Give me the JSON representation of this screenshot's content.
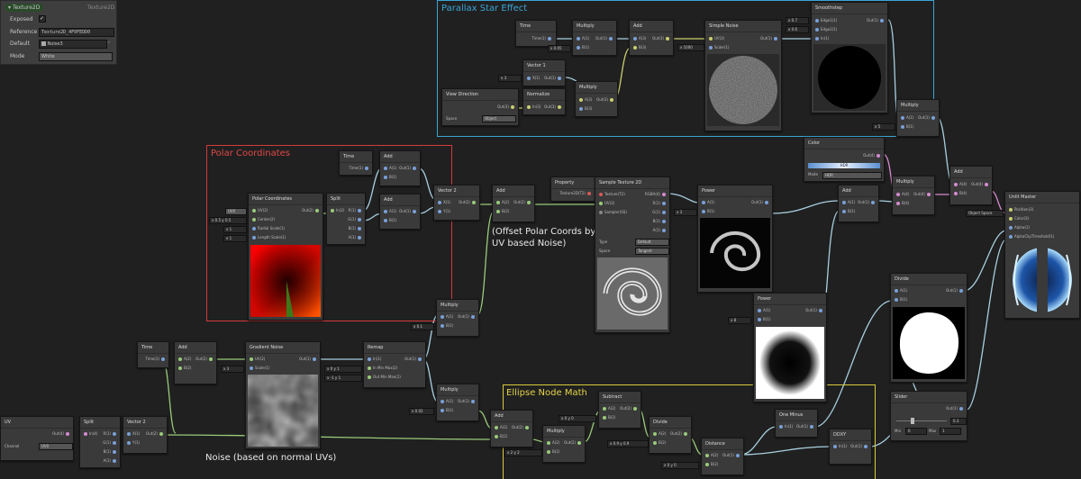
{
  "blackboard": {
    "property_name": "Texture2D",
    "property_type": "Texture2D",
    "exposed_label": "Exposed",
    "reference_label": "Reference",
    "reference_value": "Texture2D_4F0FEDD0",
    "default_label": "Default",
    "default_value": "Noise3",
    "mode_label": "Mode",
    "mode_value": "White"
  },
  "groups": {
    "parallax": "Parallax Star Effect",
    "polar": "Polar Coordinates",
    "ellipse": "Ellipse Node Math"
  },
  "comments": {
    "offset_line1": "(Offset Polar Coords by",
    "offset_line2": "UV based Noise)",
    "noise": "Noise (based on normal UVs)"
  },
  "nodes": {
    "time_top": {
      "title": "Time",
      "out": "Time(1)"
    },
    "multiply_top": {
      "title": "Multiply",
      "a": "A(1)",
      "b": "B(1)",
      "out": "Out(1)",
      "val": "0.05"
    },
    "add_top": {
      "title": "Add",
      "a": "A(3)",
      "b": "B(3)",
      "out": "Out(3)"
    },
    "simple_noise": {
      "title": "Simple Noise",
      "uv": "UV(2)",
      "scale": "Scale(1)",
      "out": "Out(1)",
      "val": "1000"
    },
    "smoothstep": {
      "title": "Smoothstep",
      "e1": "Edge1(1)",
      "e2": "Edge2(1)",
      "in": "In(1)",
      "out": "Out(1)",
      "v1": "0.7",
      "v2": "0.6"
    },
    "vector1": {
      "title": "Vector 1",
      "x": "X(1)",
      "out": "Out(1)",
      "val": "3"
    },
    "normalize": {
      "title": "Normalize",
      "in": "In(3)",
      "out": "Out(3)"
    },
    "multiply_par": {
      "title": "Multiply",
      "a": "A(3)",
      "b": "B(3)",
      "out": "Out(3)"
    },
    "view_direction": {
      "title": "View Direction",
      "out": "Out(3)",
      "space_label": "Space",
      "space_value": "Object"
    },
    "multiply_right": {
      "title": "Multiply",
      "a": "A(1)",
      "b": "B(1)",
      "out": "Out(1)",
      "val": "5"
    },
    "color": {
      "title": "Color",
      "out": "Out(4)",
      "mode_label": "Mode",
      "mode_value": "HDR",
      "hdr": "HDR"
    },
    "multiply_color": {
      "title": "Multiply",
      "a": "A(4)",
      "b": "B(4)",
      "out": "Out(4)"
    },
    "add_final": {
      "title": "Add",
      "a": "A(4)",
      "b": "B(4)",
      "out": "Out(4)"
    },
    "unlit_master": {
      "title": "Unlit Master",
      "space": "Object Space",
      "p1": "Position(3)",
      "p2": "Color(3)",
      "p3": "Alpha(1)",
      "p4": "AlphaClipThreshold(1)"
    },
    "time_polar": {
      "title": "Time",
      "out": "Time(1)"
    },
    "add_polar1": {
      "title": "Add",
      "a": "A(1)",
      "b": "B(1)",
      "out": "Out(1)"
    },
    "add_polar2": {
      "title": "Add",
      "a": "A(1)",
      "b": "B(1)",
      "out": "Out(1)"
    },
    "polar_coords": {
      "title": "Polar Coordinates",
      "uv": "UV(2)",
      "center": "Center(2)",
      "radial": "Radial Scale(1)",
      "length": "Length Scale(1)",
      "out": "Out(2)",
      "uvval": "UV0",
      "cx": "0.5",
      "cy": "0.5",
      "rv": "1",
      "lv": "1"
    },
    "split_polar": {
      "title": "Split",
      "in": "In(2)",
      "r": "R(1)",
      "g": "G(1)",
      "b": "B(1)",
      "a": "A(1)"
    },
    "vector2_polar": {
      "title": "Vector 2",
      "x": "X(1)",
      "y": "Y(1)",
      "out": "Out(2)"
    },
    "add_mid": {
      "title": "Add",
      "a": "A(2)",
      "b": "B(2)",
      "out": "Out(2)"
    },
    "property": {
      "title": "Property",
      "out": "Texture2D(T2)"
    },
    "sample_tex": {
      "title": "Sample Texture 2D",
      "tex": "Texture(T2)",
      "uv": "UV(2)",
      "sampler": "Sampler(SS)",
      "rgba": "RGBA(4)",
      "r": "R(1)",
      "g": "G(1)",
      "b": "B(1)",
      "a": "A(1)",
      "type_label": "Type",
      "type_value": "Default",
      "space_label": "Space",
      "space_value": "Tangent"
    },
    "power_top": {
      "title": "Power",
      "a": "A(1)",
      "b": "B(1)",
      "out": "Out(1)",
      "val": "3"
    },
    "add_right": {
      "title": "Add",
      "a": "A(1)",
      "b": "B(1)",
      "out": "Out(1)"
    },
    "multiply_mid": {
      "title": "Multiply",
      "a": "A(1)",
      "b": "B(1)",
      "out": "Out(1)",
      "val": "0.1"
    },
    "multiply_low": {
      "title": "Multiply",
      "a": "A(1)",
      "b": "B(1)",
      "out": "Out(1)",
      "val": "0.02"
    },
    "time_noise": {
      "title": "Time",
      "out": "Time(1)"
    },
    "add_noise": {
      "title": "Add",
      "a": "A(2)",
      "b": "B(2)",
      "out": "Out(2)"
    },
    "gradient_noise": {
      "title": "Gradient Noise",
      "uv": "UV(2)",
      "scale": "Scale(1)",
      "out": "Out(1)",
      "val": "3"
    },
    "remap": {
      "title": "Remap",
      "in": "In(1)",
      "inmm": "In Min Max(2)",
      "outmm": "Out Min Max(2)",
      "out": "Out(1)",
      "v1": "0",
      "v2": "1",
      "v3": "-1",
      "v4": "1"
    },
    "power_low": {
      "title": "Power",
      "a": "A(1)",
      "b": "B(1)",
      "out": "Out(1)",
      "val": "8"
    },
    "divide_right": {
      "title": "Divide",
      "a": "A(1)",
      "b": "B(1)",
      "out": "Out(1)"
    },
    "uv_node": {
      "title": "UV",
      "out": "Out(4)",
      "channel_label": "Channel",
      "channel_value": "UV0"
    },
    "split_uv": {
      "title": "Split",
      "in": "In(4)",
      "r": "R(1)",
      "g": "G(1)",
      "b": "B(1)",
      "a": "A(1)"
    },
    "vector2_uv": {
      "title": "Vector 2",
      "x": "X(1)",
      "y": "Y(1)",
      "out": "Out(2)"
    },
    "add_ell": {
      "title": "Add",
      "a": "A(2)",
      "b": "B(2)",
      "out": "Out(2)"
    },
    "subtract": {
      "title": "Subtract",
      "a": "A(2)",
      "b": "B(2)",
      "out": "Out(2)",
      "v1": "0",
      "v2": "0"
    },
    "multiply_ell": {
      "title": "Multiply",
      "a": "A(2)",
      "b": "B(2)",
      "out": "Out(2)",
      "v1": "2",
      "v2": "2"
    },
    "divide_ell": {
      "title": "Divide",
      "a": "A(2)",
      "b": "B(2)",
      "out": "Out(2)",
      "v1": "0.9",
      "v2": "0.9"
    },
    "distance": {
      "title": "Distance",
      "a": "A(2)",
      "b": "B(2)",
      "out": "Out(1)",
      "v1": "0",
      "v2": "0"
    },
    "one_minus": {
      "title": "One Minus",
      "in": "In(1)",
      "out": "Out(1)"
    },
    "ddxy": {
      "title": "DDXY",
      "in": "In(1)",
      "out": "Out(1)"
    },
    "slider": {
      "title": "Slider",
      "out": "Out(1)",
      "val": "0.3",
      "min_label": "Min",
      "min": "0",
      "max_label": "Max",
      "max": "1"
    }
  }
}
